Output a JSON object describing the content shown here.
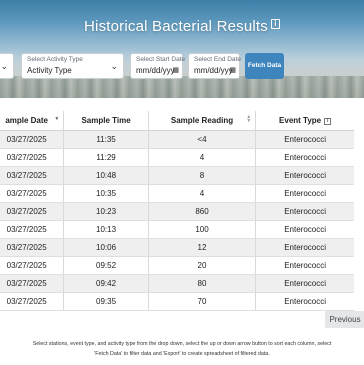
{
  "header": {
    "title": "Historical Bacterial Results",
    "info_icon": "info-icon"
  },
  "filters": {
    "station": {
      "chevron": "⌄"
    },
    "activity": {
      "label": "Select Activity Type",
      "value": "Activity Type",
      "chevron": "⌄"
    },
    "start_date": {
      "label": "Select Start Date",
      "value": "mm/dd/yyy"
    },
    "end_date": {
      "label": "Select End Date",
      "value": "mm/dd/yyy"
    },
    "fetch_label": "Fetch Data"
  },
  "table": {
    "columns": [
      "ample Date",
      "Sample Time",
      "Sample Reading",
      "Event Type"
    ],
    "rows": [
      [
        "03/27/2025",
        "11:35",
        "<4",
        "Enterococci"
      ],
      [
        "03/27/2025",
        "11:29",
        "4",
        "Enterococci"
      ],
      [
        "03/27/2025",
        "10:48",
        "8",
        "Enterococci"
      ],
      [
        "03/27/2025",
        "10:35",
        "4",
        "Enterococci"
      ],
      [
        "03/27/2025",
        "10:23",
        "860",
        "Enterococci"
      ],
      [
        "03/27/2025",
        "10:13",
        "100",
        "Enterococci"
      ],
      [
        "03/27/2025",
        "10:06",
        "12",
        "Enterococci"
      ],
      [
        "03/27/2025",
        "09:52",
        "20",
        "Enterococci"
      ],
      [
        "03/27/2025",
        "09:42",
        "80",
        "Enterococci"
      ],
      [
        "03/27/2025",
        "09:35",
        "70",
        "Enterococci"
      ]
    ]
  },
  "pagination": {
    "previous_label": "Previous"
  },
  "help": {
    "line1": "Select stations, event type, and activity type from the drop down, select the up or down arrow button to sort each column, select",
    "line2": "'Fetch Data' to filter data and 'Export' to create spreadsheet of filtered data."
  }
}
